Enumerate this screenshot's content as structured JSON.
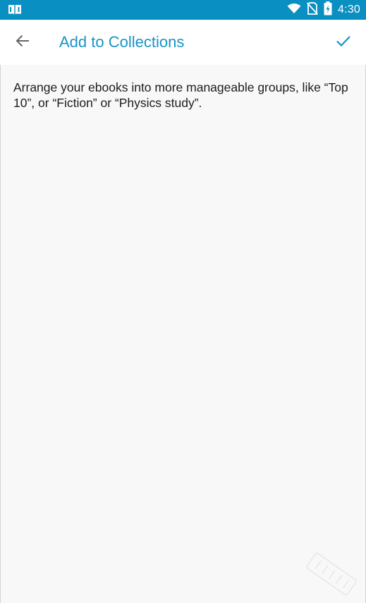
{
  "status_bar": {
    "time": "4:30",
    "color": "#0a8fc2",
    "icons": [
      "book-app-icon",
      "wifi-icon",
      "no-sim-icon",
      "battery-charging-icon"
    ]
  },
  "app_bar": {
    "title": "Add to Collections",
    "title_color": "#1a93c5",
    "back_icon": "arrow-left-icon",
    "confirm_icon": "checkmark-icon"
  },
  "content": {
    "description": "Arrange your ebooks into more manageable groups, like “Top 10”, or “Fiction” or “Physics study”."
  }
}
